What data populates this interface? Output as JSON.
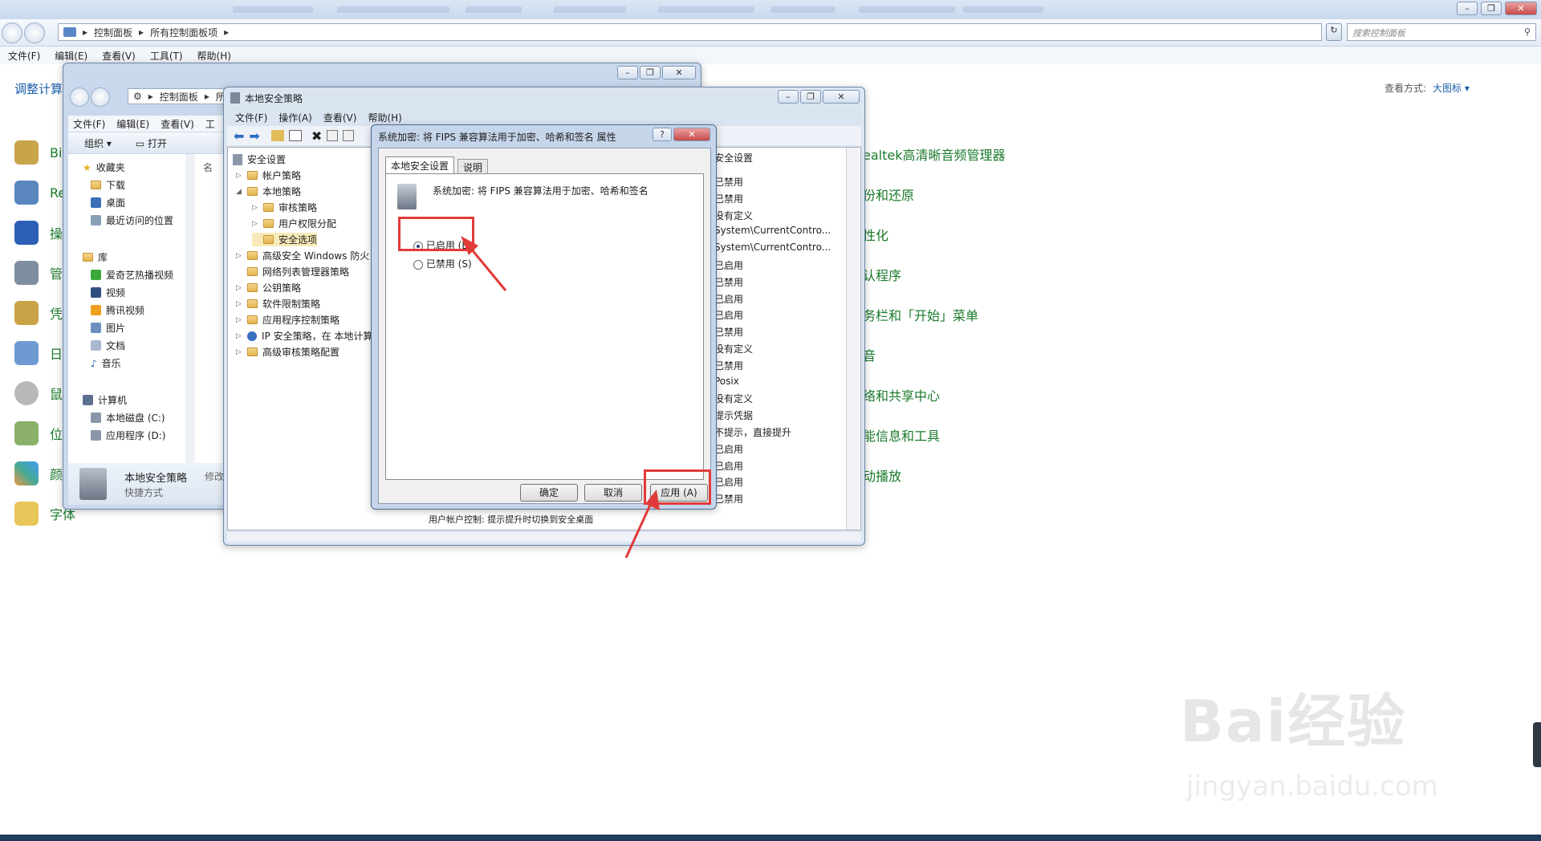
{
  "control_panel": {
    "breadcrumb": [
      "控制面板",
      "所有控制面板项"
    ],
    "search_placeholder": "搜索控制面板",
    "menu": [
      "文件(F)",
      "编辑(E)",
      "查看(V)",
      "工具(T)",
      "帮助(H)"
    ],
    "left_title": "调整计算",
    "view_label": "查看方式:",
    "view_value": "大图标 ▾",
    "left_items": [
      "Bit",
      "Re",
      "操",
      "管",
      "凭",
      "日",
      "鼠",
      "位",
      "颜",
      "字体"
    ],
    "right_items": [
      "ealtek高清晰音频管理器",
      "份和还原",
      "性化",
      "认程序",
      "务栏和「开始」菜单",
      "音",
      "络和共享中心",
      "能信息和工具",
      "动播放"
    ]
  },
  "explorer": {
    "breadcrumb": [
      "控制面板",
      "所"
    ],
    "menu": [
      "文件(F)",
      "编辑(E)",
      "查看(V)",
      "工"
    ],
    "toolbar": {
      "organize": "组织 ▾",
      "open": "打开"
    },
    "nav": {
      "favorites": "收藏夹",
      "favorites_items": [
        "下载",
        "桌面",
        "最近访问的位置"
      ],
      "library": "库",
      "library_items": [
        "爱奇艺热播视频",
        "视频",
        "腾讯视频",
        "图片",
        "文档",
        "音乐"
      ],
      "computer": "计算机",
      "computer_items": [
        "本地磁盘 (C:)",
        "应用程序 (D:)"
      ]
    },
    "col_header": "名",
    "details": {
      "name": "本地安全策略",
      "type": "快捷方式",
      "modified": "修改"
    }
  },
  "secpol": {
    "title": "本地安全策略",
    "menu": [
      "文件(F)",
      "操作(A)",
      "查看(V)",
      "帮助(H)"
    ],
    "tree": {
      "root": "安全设置",
      "items": [
        "帐户策略",
        "本地策略",
        "审核策略",
        "用户权限分配",
        "安全选项",
        "高级安全 Windows 防火",
        "网络列表管理器策略",
        "公钥策略",
        "软件限制策略",
        "应用程序控制策略",
        "IP 安全策略，在 本地计算",
        "高级审核策略配置"
      ]
    },
    "column_header": "安全设置",
    "values": [
      "已禁用",
      "已禁用",
      "没有定义",
      "System\\CurrentContro...",
      "System\\CurrentContro...",
      "已启用",
      "已禁用",
      "已启用",
      "已启用",
      "已禁用",
      "没有定义",
      "已禁用",
      "Posix",
      "没有定义",
      "提示凭据",
      "不提示，直接提升",
      "已启用",
      "已启用",
      "已启用",
      "已禁用"
    ],
    "bottom_row": "用户帐户控制: 提示提升时切换到安全桌面"
  },
  "dialog": {
    "title": "系统加密: 将 FIPS 兼容算法用于加密、哈希和签名 属性",
    "help": "?",
    "tabs": [
      "本地安全设置",
      "说明"
    ],
    "policy_name": "系统加密: 将 FIPS 兼容算法用于加密、哈希和签名",
    "radio_enabled": "已启用 (E)",
    "radio_disabled": "已禁用 (S)",
    "ok": "确定",
    "cancel": "取消",
    "apply": "应用 (A)"
  },
  "watermark": {
    "brand": "Bai经验",
    "url": "jingyan.baidu.com"
  },
  "colors": {
    "annotation": "#e23a3a",
    "link": "#1a5ea8",
    "cp_item": "#1a7a2a"
  }
}
